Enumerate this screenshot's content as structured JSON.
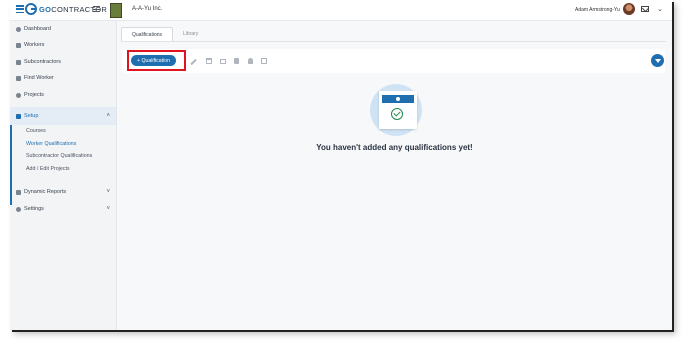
{
  "app": {
    "logo_prefix": "GO",
    "logo_suffix": "CONTRACTOR",
    "company": "A-A-Yu Inc.",
    "user": "Adam Armstrong-Yu"
  },
  "sidebar": {
    "items": [
      {
        "label": "Dashboard"
      },
      {
        "label": "Workers"
      },
      {
        "label": "Subcontractors"
      },
      {
        "label": "Find Worker"
      },
      {
        "label": "Projects"
      },
      {
        "label": "Setup"
      },
      {
        "label": "Dynamic Reports"
      },
      {
        "label": "Settings"
      }
    ],
    "setup_children": [
      {
        "label": "Courses"
      },
      {
        "label": "Worker Qualifications"
      },
      {
        "label": "Subcontractor Qualifications"
      },
      {
        "label": "Add / Edit Projects"
      }
    ]
  },
  "tabs": [
    {
      "label": "Qualifications"
    },
    {
      "label": "Library"
    }
  ],
  "toolbar": {
    "add_label": "+ Qualification"
  },
  "empty_state": {
    "message": "You haven't added any qualifications yet!"
  },
  "colors": {
    "accent": "#1f6fb0",
    "highlight": "#e0141e",
    "success": "#1e8a4a"
  }
}
